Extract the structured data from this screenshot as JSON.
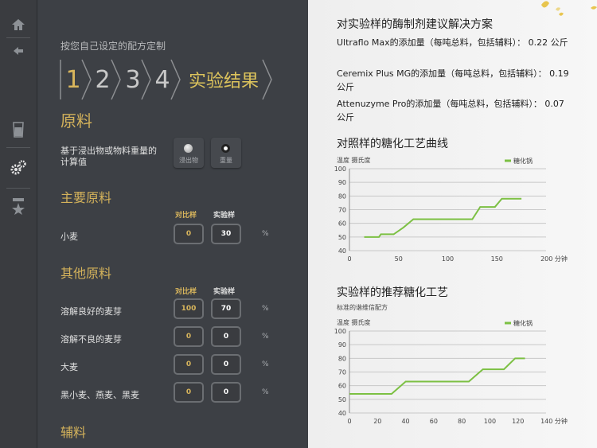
{
  "sidebar": {
    "items": [
      "home",
      "back",
      "glass",
      "settings",
      "star"
    ]
  },
  "left": {
    "subtitle": "按您自己设定的配方定制",
    "steps": [
      "1",
      "2",
      "3",
      "4"
    ],
    "current_step": "实验结果",
    "raw_title": "原料",
    "calc_label": "基于浸出物或物料重量的计算值",
    "radio": {
      "opt1": "浸出物",
      "opt2": "重量",
      "selected": "重量"
    },
    "main_title": "主要原料",
    "col_control": "对比样",
    "col_test": "实验样",
    "pct": "%",
    "main_rows": [
      {
        "name": "小麦",
        "control": "0",
        "test": "30"
      }
    ],
    "other_title": "其他原料",
    "other_rows": [
      {
        "name": "溶解良好的麦芽",
        "control": "100",
        "test": "70"
      },
      {
        "name": "溶解不良的麦芽",
        "control": "0",
        "test": "0"
      },
      {
        "name": "大麦",
        "control": "0",
        "test": "0"
      },
      {
        "name": "黑小麦、燕麦、黑麦",
        "control": "0",
        "test": "0"
      }
    ],
    "aux_title": "辅料"
  },
  "right": {
    "sol_title": "对实验样的酶制剂建议解决方案",
    "enzymes": [
      "Ultraflo Max的添加量（每吨总料，包括辅料）： 0.22 公斤",
      "Ceremix Plus MG的添加量（每吨总料，包括辅料）： 0.19 公斤",
      "Attenuzyme Pro的添加量（每吨总料，包括辅料）： 0.07 公斤"
    ],
    "chart1_title": "对照样的糖化工艺曲线",
    "chart2_title": "实验样的推荐糖化工艺",
    "chart2_subtitle": "标准的谐维信配方"
  },
  "chart_data": [
    {
      "type": "line",
      "ylabel": "温度 摄氏度",
      "xlabel": "分钟",
      "legend": "糖化锅",
      "ylim": [
        40,
        100
      ],
      "xlim": [
        0,
        200
      ],
      "yticks": [
        40,
        50,
        60,
        70,
        80,
        90,
        100
      ],
      "xticks": [
        0,
        50,
        100,
        150,
        200
      ],
      "x_unit_label": "200 分钟",
      "series": [
        {
          "name": "糖化锅",
          "color": "#7cc043",
          "x": [
            15,
            30,
            32,
            45,
            55,
            65,
            125,
            133,
            148,
            155,
            175
          ],
          "y": [
            50,
            50,
            52,
            52,
            57,
            63,
            63,
            72,
            72,
            78,
            78
          ]
        }
      ]
    },
    {
      "type": "line",
      "ylabel": "温度 摄氏度",
      "xlabel": "分钟",
      "legend": "糖化锅",
      "ylim": [
        40,
        100
      ],
      "xlim": [
        0,
        140
      ],
      "yticks": [
        40,
        50,
        60,
        70,
        80,
        90,
        100
      ],
      "xticks": [
        0,
        20,
        40,
        60,
        80,
        100,
        120,
        140
      ],
      "x_unit_label": "140 分钟",
      "series": [
        {
          "name": "糖化锅",
          "color": "#7cc043",
          "x": [
            0,
            30,
            40,
            85,
            95,
            110,
            118,
            125
          ],
          "y": [
            54,
            54,
            63,
            63,
            72,
            72,
            80,
            80
          ]
        }
      ]
    }
  ]
}
